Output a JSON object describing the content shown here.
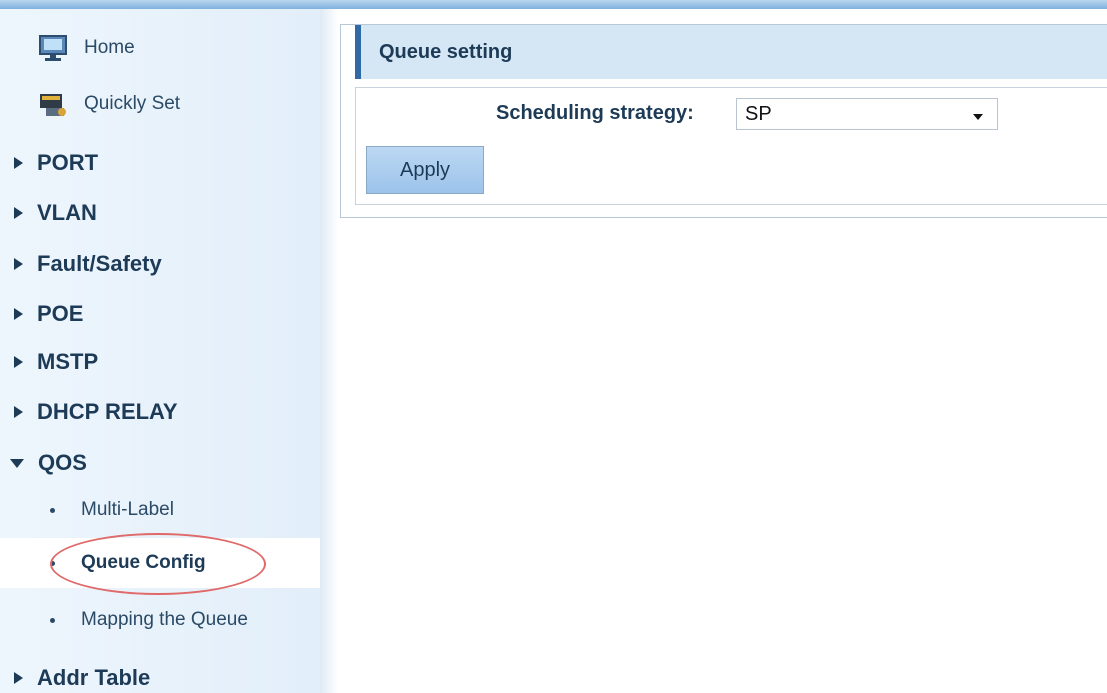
{
  "sidebar": {
    "top_items": [
      {
        "label": "Home",
        "icon": "home-monitor-icon"
      },
      {
        "label": "Quickly Set",
        "icon": "quick-set-icon"
      }
    ],
    "groups": [
      {
        "label": "PORT"
      },
      {
        "label": "VLAN"
      },
      {
        "label": "Fault/Safety"
      },
      {
        "label": "POE"
      },
      {
        "label": "MSTP"
      },
      {
        "label": "DHCP RELAY"
      },
      {
        "label": "QOS"
      },
      {
        "label": "Addr Table"
      }
    ],
    "qos_sub_items": [
      {
        "label": "Multi-Label"
      },
      {
        "label": "Queue Config"
      },
      {
        "label": "Mapping the Queue"
      }
    ],
    "selected_sub_item": "Queue Config"
  },
  "panel": {
    "title": "Queue setting",
    "scheduling_label": "Scheduling strategy:",
    "scheduling_value": "SP",
    "apply_label": "Apply"
  },
  "colors": {
    "accent": "#2f6aa4",
    "header_bg": "#d5e6f5",
    "highlight_circle": "#e06a6a"
  }
}
